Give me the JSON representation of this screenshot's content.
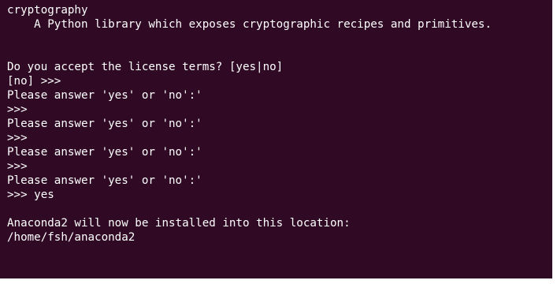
{
  "terminal": {
    "colors": {
      "background": "#300a24",
      "foreground": "#ffffff"
    },
    "lines": [
      "cryptography",
      "    A Python library which exposes cryptographic recipes and primitives.",
      "",
      "",
      "Do you accept the license terms? [yes|no]",
      "[no] >>>",
      "Please answer 'yes' or 'no':'",
      ">>>",
      "Please answer 'yes' or 'no':'",
      ">>>",
      "Please answer 'yes' or 'no':'",
      ">>>",
      "Please answer 'yes' or 'no':'",
      ">>> yes",
      "",
      "Anaconda2 will now be installed into this location:",
      "/home/fsh/anaconda2"
    ]
  }
}
